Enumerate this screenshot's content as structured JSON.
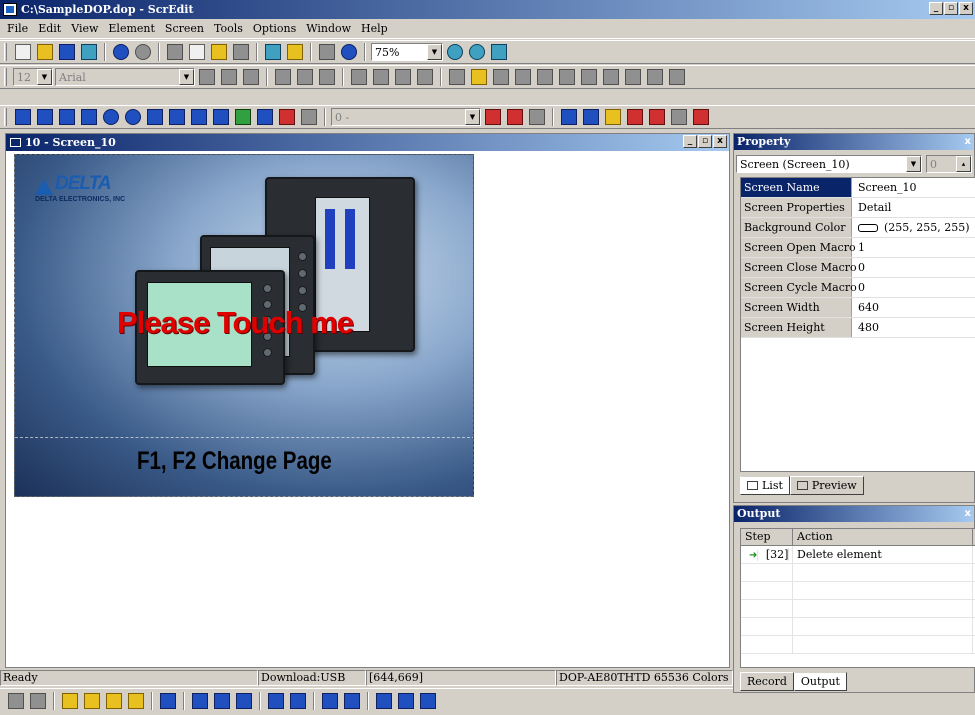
{
  "window": {
    "title": "C:\\SampleDOP.dop - ScrEdit",
    "controls": [
      "_",
      "▫",
      "x"
    ]
  },
  "menu": [
    "File",
    "Edit",
    "View",
    "Element",
    "Screen",
    "Tools",
    "Options",
    "Window",
    "Help"
  ],
  "toolbar": {
    "zoom": "75%",
    "font_size": "12",
    "font_name": "Arial",
    "element_id": "0 -"
  },
  "editor": {
    "title": "10 - Screen_10",
    "canvas_text_touch": "Please Touch me",
    "canvas_text_page": "F1, F2  Change Page",
    "logo_name": "DELTA",
    "logo_sub": "DELTA ELECTRONICS, INC"
  },
  "property": {
    "title": "Property",
    "close": "x",
    "selector": "Screen (Screen_10)",
    "spin_value": "0",
    "rows": [
      {
        "key": "Screen Name",
        "value": "Screen_10"
      },
      {
        "key": "Screen Properties",
        "value": "Detail"
      },
      {
        "key": "Background Color",
        "value": "(255, 255, 255)"
      },
      {
        "key": "Screen Open Macro",
        "value": "1"
      },
      {
        "key": "Screen Close Macro",
        "value": "0"
      },
      {
        "key": "Screen Cycle Macro",
        "value": "0"
      },
      {
        "key": "Screen Width",
        "value": "640"
      },
      {
        "key": "Screen Height",
        "value": "480"
      }
    ],
    "tabs": [
      "List",
      "Preview"
    ]
  },
  "output": {
    "title": "Output",
    "close": "x",
    "columns": [
      "Step",
      "Action"
    ],
    "rows": [
      {
        "step": "[32]",
        "action": "Delete element"
      }
    ],
    "tabs": [
      "Record",
      "Output"
    ]
  },
  "status": {
    "ready": "Ready",
    "download": "Download:USB",
    "coords": "[644,669]",
    "model": "DOP-AE80THTD 65536 Colors"
  },
  "colors": {
    "title_start": "#0a246a",
    "title_end": "#a6caf0",
    "canvas_text": "#e00000"
  }
}
